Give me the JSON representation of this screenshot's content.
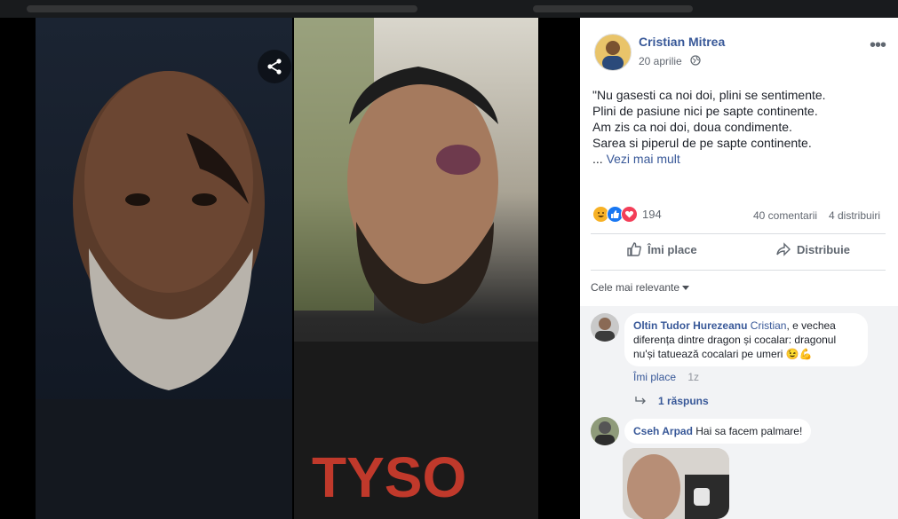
{
  "post": {
    "author": "Cristian Mitrea",
    "date": "20 aprilie",
    "more_label": "•••",
    "text_lines": [
      "\"Nu gasesti ca noi doi, plini se sentimente.",
      "Plini de pasiune nici pe sapte continente.",
      "Am zis ca noi doi, doua condimente.",
      "Sarea si piperul de pe sapte continente."
    ],
    "ellipsis": "...",
    "see_more": "Vezi mai mult",
    "reaction_count": "194",
    "comments_count": "40 comentarii",
    "shares_count": "4 distribuiri",
    "like_label": "Îmi place",
    "share_label": "Distribuie",
    "sort_label": "Cele mai relevante"
  },
  "comments": [
    {
      "author": "Oltin Tudor Hurezeanu",
      "mention": "Cristian",
      "text_line1": ", e vechea",
      "text_line2": "diferența dintre dragon și cocalar: dragonul",
      "text_line3": "nu'și tatuează cocalari pe umeri",
      "emoji": "😉💪",
      "like_label": "Îmi place",
      "time": "1z",
      "replies": "1 răspuns"
    },
    {
      "author": "Cseh Arpad",
      "text": "Hai sa facem palmare!"
    }
  ],
  "colors": {
    "link": "#385898",
    "muted": "#616770",
    "like_reaction": "#1877f2",
    "love_reaction": "#f33e58",
    "haha_reaction": "#f7b125"
  },
  "icons": {
    "share": "share-icon",
    "globe": "globe-icon",
    "thumbs_up": "thumbs-up-icon",
    "share_arrow": "share-arrow-icon",
    "caret": "caret-down-icon",
    "reply_arrow": "reply-arrow-icon"
  }
}
